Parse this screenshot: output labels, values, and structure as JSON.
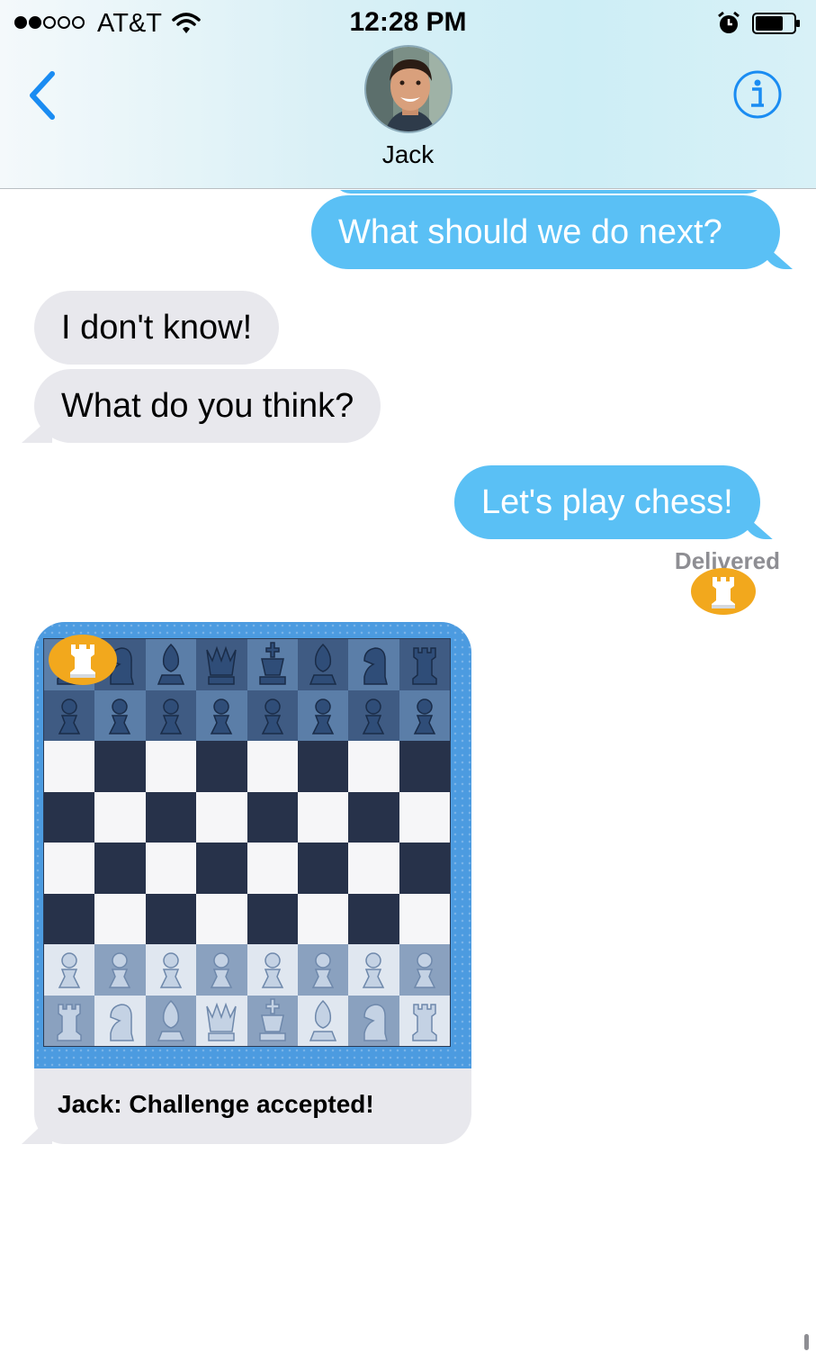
{
  "status_bar": {
    "carrier": "AT&T",
    "time": "12:28 PM",
    "signal_bars_filled": 2,
    "signal_bars_total": 5
  },
  "header": {
    "contact_name": "Jack",
    "back_icon": "chevron-left-icon",
    "info_icon": "info-icon",
    "accent_color": "#1a8cf2"
  },
  "messages": [
    {
      "direction": "outgoing",
      "text": "What should we do next?"
    },
    {
      "direction": "incoming",
      "text": "I don't know!"
    },
    {
      "direction": "incoming",
      "text": "What do you think?"
    },
    {
      "direction": "outgoing",
      "text": "Let's play chess!"
    }
  ],
  "delivery_status": "Delivered",
  "game_card": {
    "caption": "Jack: Challenge accepted!",
    "app_icon": "rook-badge-icon",
    "board": {
      "black_back_rank": [
        "rook",
        "knight",
        "bishop",
        "queen",
        "king",
        "bishop",
        "knight",
        "rook"
      ],
      "black_pawns": 8,
      "white_back_rank": [
        "rook",
        "knight",
        "bishop",
        "queen",
        "king",
        "bishop",
        "knight",
        "rook"
      ],
      "white_pawns": 8
    }
  },
  "colors": {
    "outgoing_bubble": "#5ac0f5",
    "incoming_bubble": "#e8e8ed",
    "board_frame": "#4c9be0",
    "badge": "#f2a81d"
  }
}
